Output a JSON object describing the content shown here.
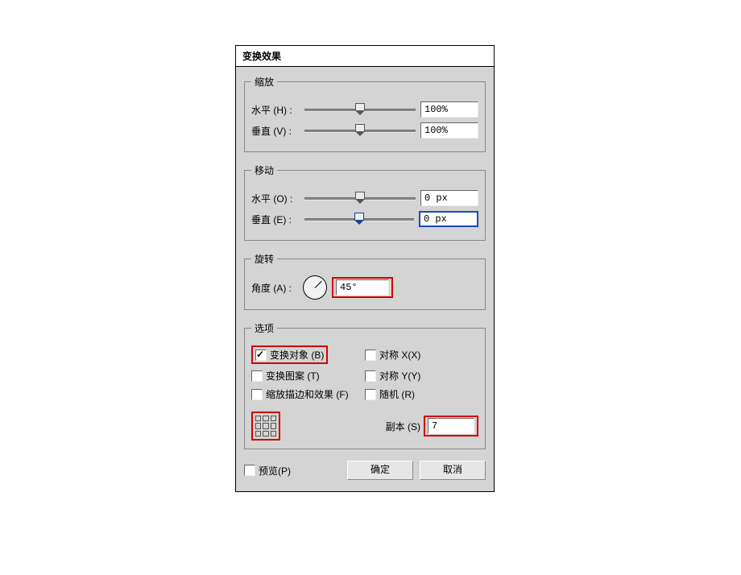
{
  "dialog": {
    "title": "变换效果"
  },
  "scale": {
    "legend": "缩放",
    "h_label": "水平 (H) :",
    "h_value": "100%",
    "v_label": "垂直 (V) :",
    "v_value": "100%"
  },
  "move": {
    "legend": "移动",
    "h_label": "水平 (O) :",
    "h_value": "0 px",
    "v_label": "垂直 (E) :",
    "v_value": "0 px"
  },
  "rotate": {
    "legend": "旋转",
    "angle_label": "角度 (A) :",
    "angle_value": "45°"
  },
  "options": {
    "legend": "选项",
    "transform_objects": "变换对象 (B)",
    "reflect_x": "对称 X(X)",
    "transform_patterns": "变换图案 (T)",
    "reflect_y": "对称 Y(Y)",
    "scale_strokes": "缩放描边和效果 (F)",
    "random": "随机 (R)",
    "copies_label": "副本 (S)",
    "copies_value": "7"
  },
  "footer": {
    "preview": "预览(P)",
    "ok": "确定",
    "cancel": "取消"
  }
}
